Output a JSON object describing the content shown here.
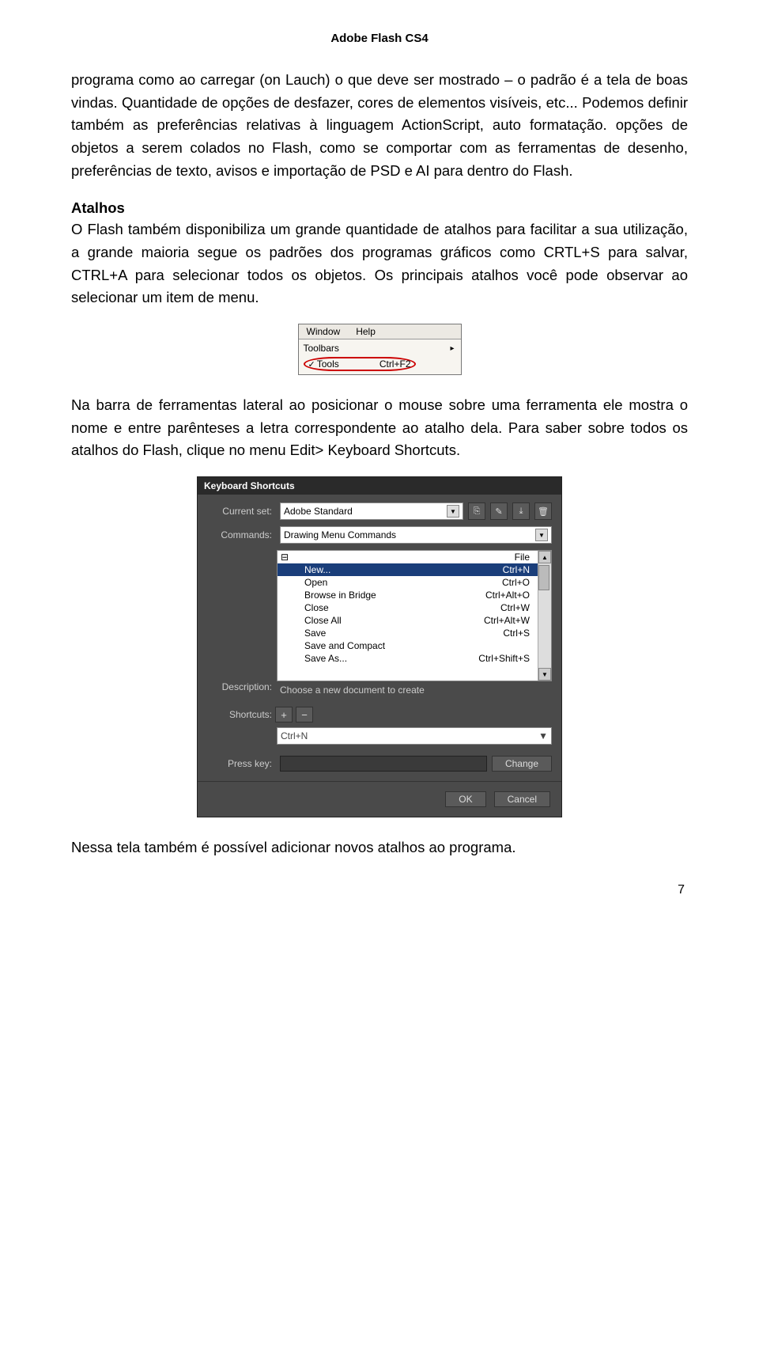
{
  "doc_title": "Adobe Flash CS4",
  "para1": "programa como ao carregar (on Lauch) o que deve ser mostrado – o padrão é a tela de boas vindas. Quantidade de opções de desfazer, cores de elementos visíveis, etc... Podemos definir também as preferências relativas à linguagem ActionScript, auto formatação. opções de objetos a serem colados no Flash, como se comportar com as ferramentas de desenho, preferências de texto, avisos e importação de PSD e AI para dentro do Flash.",
  "section_title": "Atalhos",
  "para2": "O Flash também disponibiliza um grande quantidade de atalhos para facilitar a sua utilização, a grande maioria segue os padrões dos programas gráficos como CRTL+S para salvar, CTRL+A para selecionar todos os objetos. Os principais atalhos você pode observar ao selecionar um item de menu.",
  "menu": {
    "window": "Window",
    "help": "Help",
    "toolbars": "Toolbars",
    "tools": "Tools",
    "tools_shortcut": "Ctrl+F2"
  },
  "para3": "Na barra de ferramentas lateral ao posicionar o mouse sobre uma ferramenta ele mostra o nome e entre parênteses a letra correspondente ao atalho dela. Para saber sobre todos os atalhos do Flash, clique no menu Edit> Keyboard Shortcuts.",
  "dialog": {
    "title": "Keyboard Shortcuts",
    "labels": {
      "current_set": "Current set:",
      "commands": "Commands:",
      "description": "Description:",
      "shortcuts": "Shortcuts:",
      "press_key": "Press key:"
    },
    "current_set_value": "Adobe Standard",
    "commands_value": "Drawing Menu Commands",
    "file_group": "File",
    "items": [
      {
        "name": "New...",
        "shortcut": "Ctrl+N",
        "selected": true
      },
      {
        "name": "Open",
        "shortcut": "Ctrl+O"
      },
      {
        "name": "Browse in Bridge",
        "shortcut": "Ctrl+Alt+O"
      },
      {
        "name": "Close",
        "shortcut": "Ctrl+W"
      },
      {
        "name": "Close All",
        "shortcut": "Ctrl+Alt+W"
      },
      {
        "name": "Save",
        "shortcut": "Ctrl+S"
      },
      {
        "name": "Save and Compact",
        "shortcut": ""
      },
      {
        "name": "Save As...",
        "shortcut": "Ctrl+Shift+S"
      }
    ],
    "description_value": "Choose a new document to create",
    "shortcut_value": "Ctrl+N",
    "buttons": {
      "plus": "+",
      "minus": "−",
      "change": "Change",
      "ok": "OK",
      "cancel": "Cancel"
    }
  },
  "para4": "Nessa tela também é possível adicionar novos atalhos ao programa.",
  "page_number": "7"
}
